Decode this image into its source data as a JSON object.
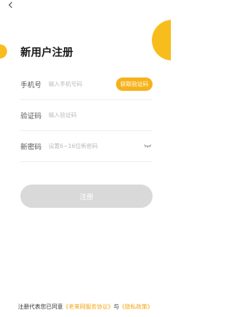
{
  "nav": {
    "back_icon": "chevron-left-icon"
  },
  "header": {
    "title": "新用户注册"
  },
  "form": {
    "phone": {
      "label": "手机号",
      "value": "",
      "placeholder": "输入手机号码",
      "get_code_label": "获取验证码"
    },
    "code": {
      "label": "验证码",
      "value": "",
      "placeholder": "输入验证码"
    },
    "password": {
      "label": "新密码",
      "value": "",
      "placeholder": "设置6~16位新密码",
      "toggle_icon": "eye-closed-icon"
    }
  },
  "register": {
    "label": "注册"
  },
  "agreement": {
    "prefix": "注册代表您已同意",
    "service_link": "《老来网服务协议》",
    "joiner": "与",
    "privacy_link": "《隐私政策》"
  },
  "colors": {
    "accent": "#f6b21b",
    "link": "#f5a50f",
    "button_disabled": "#d9d9d9"
  }
}
